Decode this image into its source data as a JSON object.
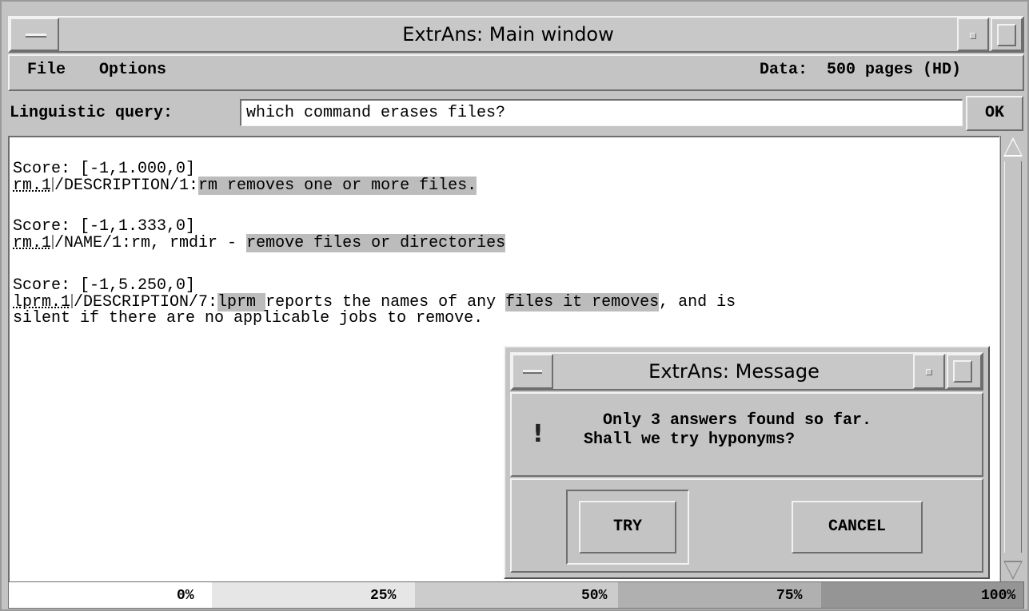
{
  "main_window": {
    "title": "ExtrAns: Main window",
    "menu": {
      "file": "File",
      "options": "Options",
      "data_status": "Data:  500 pages (HD)"
    },
    "query": {
      "label": "Linguistic query:",
      "value": "which command erases files?",
      "ok_label": "OK"
    },
    "results": [
      {
        "score": "Score: [-1,1.000,0]",
        "doc": "rm.1",
        "section": "/DESCRIPTION/1:",
        "text_parts": [
          "rm removes one or more files."
        ],
        "highlighted": [
          true
        ]
      },
      {
        "score": "Score: [-1,1.333,0]",
        "doc": "rm.1",
        "section": "/NAME/1:",
        "text_parts": [
          "rm, rmdir - ",
          "remove files or directories"
        ],
        "highlighted": [
          false,
          true
        ]
      },
      {
        "score": "Score: [-1,5.250,0]",
        "doc": "lprm.1",
        "section": "/DESCRIPTION/7:",
        "text_parts": [
          "lprm ",
          "reports the names of any ",
          "files it removes",
          ", and is"
        ],
        "highlighted": [
          true,
          false,
          true,
          false
        ],
        "continuation": "silent if there are no applicable jobs to remove."
      }
    ],
    "progress": {
      "labels": [
        "0%",
        "25%",
        "50%",
        "75%",
        "100%"
      ],
      "shades": [
        "#ffffff",
        "#e6e6e6",
        "#cccccc",
        "#b0b0b0",
        "#959595"
      ]
    }
  },
  "dialog": {
    "title": "ExtrAns: Message",
    "icon": "exclamation-icon",
    "message": "  Only 3 answers found so far.\nShall we try hyponyms?",
    "buttons": {
      "try": "TRY",
      "cancel": "CANCEL"
    }
  }
}
